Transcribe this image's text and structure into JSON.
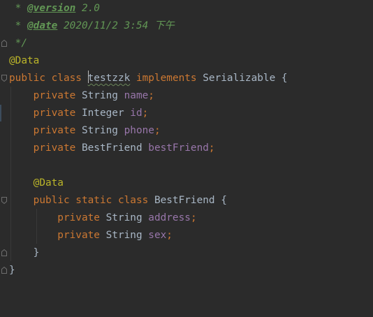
{
  "editor": {
    "lines": [
      [
        {
          "t": " * ",
          "c": "doc"
        },
        {
          "t": "@version",
          "c": "doctag"
        },
        {
          "t": " 2.0",
          "c": "doc"
        }
      ],
      [
        {
          "t": " * ",
          "c": "doc"
        },
        {
          "t": "@date",
          "c": "doctag"
        },
        {
          "t": " 2020/11/2 3:54 下午",
          "c": "doc"
        }
      ],
      [
        {
          "t": " */",
          "c": "doc"
        }
      ],
      [
        {
          "t": "@Data",
          "c": "ann"
        }
      ],
      [
        {
          "t": "public class ",
          "c": "kw"
        },
        {
          "t": "CARET",
          "c": "caret"
        },
        {
          "t": "testzzk",
          "c": "warn"
        },
        {
          "t": " implements ",
          "c": "kw"
        },
        {
          "t": "Serializable {",
          "c": "plain"
        }
      ],
      [
        {
          "t": "    private ",
          "c": "kw"
        },
        {
          "t": "String ",
          "c": "type"
        },
        {
          "t": "name",
          "c": "field"
        },
        {
          "t": ";",
          "c": "punct"
        }
      ],
      [
        {
          "t": "    private ",
          "c": "kw"
        },
        {
          "t": "Integer ",
          "c": "type"
        },
        {
          "t": "id",
          "c": "field"
        },
        {
          "t": ";",
          "c": "punct"
        }
      ],
      [
        {
          "t": "    private ",
          "c": "kw"
        },
        {
          "t": "String ",
          "c": "type"
        },
        {
          "t": "phone",
          "c": "field"
        },
        {
          "t": ";",
          "c": "punct"
        }
      ],
      [
        {
          "t": "    private ",
          "c": "kw"
        },
        {
          "t": "BestFriend ",
          "c": "type"
        },
        {
          "t": "bestFriend",
          "c": "field"
        },
        {
          "t": ";",
          "c": "punct"
        }
      ],
      [],
      [
        {
          "t": "    @Data",
          "c": "ann"
        }
      ],
      [
        {
          "t": "    public static class ",
          "c": "kw"
        },
        {
          "t": "BestFriend {",
          "c": "plain"
        }
      ],
      [
        {
          "t": "        private ",
          "c": "kw"
        },
        {
          "t": "String ",
          "c": "type"
        },
        {
          "t": "address",
          "c": "field"
        },
        {
          "t": ";",
          "c": "punct"
        }
      ],
      [
        {
          "t": "        private ",
          "c": "kw"
        },
        {
          "t": "String ",
          "c": "type"
        },
        {
          "t": "sex",
          "c": "field"
        },
        {
          "t": ";",
          "c": "punct"
        }
      ],
      [
        {
          "t": "    }",
          "c": "plain"
        }
      ],
      [
        {
          "t": "}",
          "c": "plain"
        }
      ]
    ],
    "colors": {
      "background": "#2b2b2b",
      "keyword": "#cc7832",
      "doc_comment": "#629755",
      "annotation": "#bbb529",
      "field": "#9876aa",
      "plain": "#a9b7c6"
    }
  }
}
